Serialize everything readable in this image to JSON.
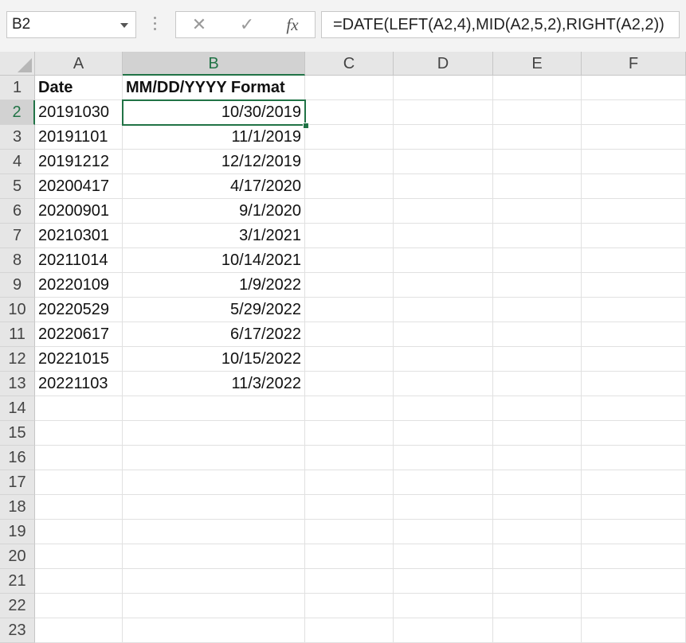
{
  "name_box": {
    "value": "B2"
  },
  "formula_bar": {
    "cancel_icon": "close-icon",
    "enter_icon": "checkmark-icon",
    "fx_label": "fx",
    "formula": "=DATE(LEFT(A2,4),MID(A2,5,2),RIGHT(A2,2))"
  },
  "selected_cell": {
    "column": "B",
    "row": 2,
    "accent": "#217346"
  },
  "columns": [
    "A",
    "B",
    "C",
    "D",
    "E",
    "F"
  ],
  "row_numbers": [
    "1",
    "2",
    "3",
    "4",
    "5",
    "6",
    "7",
    "8",
    "9",
    "10",
    "11",
    "12",
    "13",
    "14",
    "15",
    "16",
    "17",
    "18",
    "19",
    "20",
    "21",
    "22",
    "23"
  ],
  "table": {
    "headers": [
      "Date",
      "MM/DD/YYYY Format"
    ],
    "rows": [
      [
        "20191030",
        "10/30/2019"
      ],
      [
        "20191101",
        "11/1/2019"
      ],
      [
        "20191212",
        "12/12/2019"
      ],
      [
        "20200417",
        "4/17/2020"
      ],
      [
        "20200901",
        "9/1/2020"
      ],
      [
        "20210301",
        "3/1/2021"
      ],
      [
        "20211014",
        "10/14/2021"
      ],
      [
        "20220109",
        "1/9/2022"
      ],
      [
        "20220529",
        "5/29/2022"
      ],
      [
        "20220617",
        "6/17/2022"
      ],
      [
        "20221015",
        "10/15/2022"
      ],
      [
        "20221103",
        "11/3/2022"
      ]
    ]
  }
}
